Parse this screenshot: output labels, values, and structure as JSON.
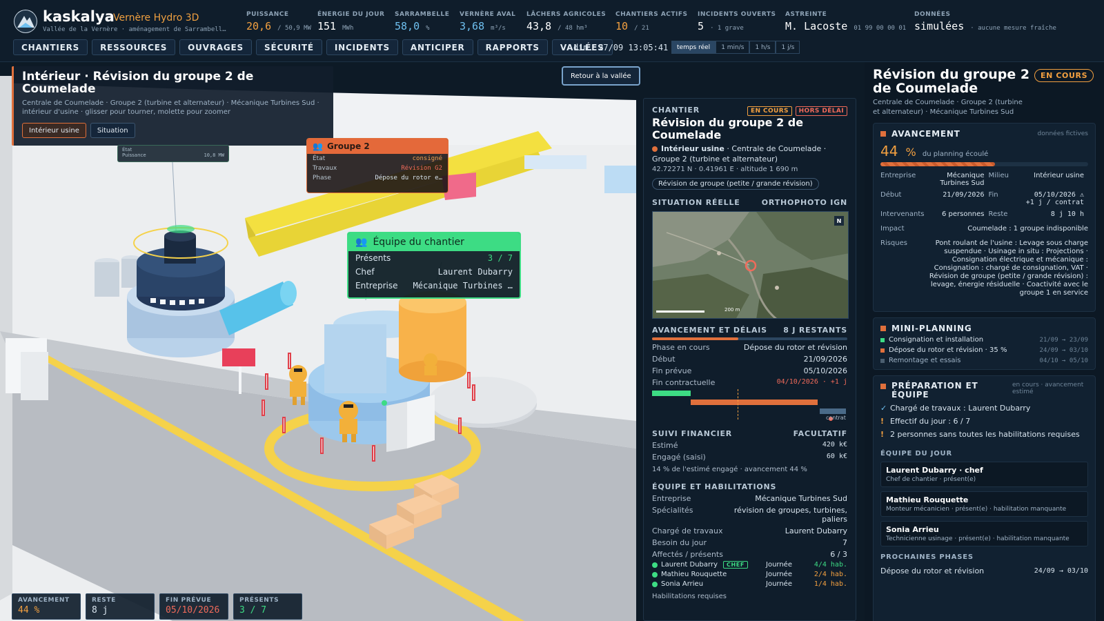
{
  "header": {
    "brand": "kaskalya",
    "product": "Vernère Hydro 3D",
    "location": "Vallée de la Vernère · aménagement de Sarrambell…",
    "kpis": [
      {
        "label": "PUISSANCE",
        "value": "20,6",
        "unit": "/ 50,9 MW",
        "color": "#f3a040"
      },
      {
        "label": "ÉNERGIE DU JOUR",
        "value": "151",
        "unit": "MWh",
        "color": "#ffffff"
      },
      {
        "label": "SARRAMBELLE",
        "value": "58,0",
        "unit": "%",
        "color": "#6fc0f0"
      },
      {
        "label": "VERNÈRE AVAL",
        "value": "3,68",
        "unit": "m³/s",
        "color": "#6fc0f0"
      },
      {
        "label": "LÂCHERS AGRICOLES",
        "value": "43,8",
        "unit": "/ 48 hm³",
        "color": "#ffffff"
      },
      {
        "label": "CHANTIERS ACTIFS",
        "value": "10",
        "unit": "/ 21",
        "color": "#f3a040"
      },
      {
        "label": "INCIDENTS OUVERTS",
        "value": "5",
        "unit": "· 1 grave",
        "color": "#ffffff"
      },
      {
        "label": "ASTREINTE",
        "value": "M. Lacoste",
        "unit": "01 99 00 00 01",
        "color": "#ffffff"
      },
      {
        "label": "DONNÉES",
        "value": "simulées",
        "unit": "· aucune mesure fraîche",
        "color": "#ffffff"
      }
    ],
    "nav": [
      "CHANTIERS",
      "RESSOURCES",
      "OUVRAGES",
      "SÉCURITÉ",
      "INCIDENTS",
      "ANTICIPER",
      "RAPPORTS",
      "VALLÉES"
    ],
    "clock": "dim. 27/09 13:05:41",
    "speeds": [
      "temps réel",
      "1 min/s",
      "1 h/s",
      "1 j/s"
    ],
    "speed_active": "temps réel"
  },
  "scene": {
    "title": "Intérieur · Révision du groupe 2 de Coumelade",
    "sub1": "Centrale de Coumelade · Groupe 2 (turbine et alternateur) · Mécanique Turbines Sud ·",
    "sub2": "intérieur d'usine · glisser pour tourner, molette pour zoomer",
    "views": [
      "Intérieur usine",
      "Situation"
    ],
    "back": "Retour à la vallée",
    "ghost": {
      "k1": "État",
      "k2": "Puissance",
      "v2": "10,8 MW"
    },
    "g2": {
      "title": "Groupe 2",
      "rows": [
        {
          "k": "État",
          "v": "consigné"
        },
        {
          "k": "Travaux",
          "v": "Révision G2"
        },
        {
          "k": "Phase",
          "v": "Dépose du rotor e…"
        }
      ]
    },
    "team": {
      "title": "Équipe du chantier",
      "rows": [
        {
          "k": "Présents",
          "v": "3 / 7"
        },
        {
          "k": "Chef",
          "v": "Laurent Dubarry"
        },
        {
          "k": "Entreprise",
          "v": "Mécanique Turbines …"
        }
      ]
    },
    "bottom": [
      {
        "label": "AVANCEMENT",
        "value": "44 %",
        "color": "#f3a040"
      },
      {
        "label": "RESTE",
        "value": "8 j",
        "color": "#ffffff"
      },
      {
        "label": "FIN PRÉVUE",
        "value": "05/10/2026",
        "color": "#f06a5a"
      },
      {
        "label": "PRÉSENTS",
        "value": "3 / 7",
        "color": "#3ddc84"
      }
    ]
  },
  "mid": {
    "section": "CHANTIER",
    "badge1": "EN COURS",
    "badge2": "HORS DÉLAI",
    "title": "Révision du groupe 2 de Coumelade",
    "line1_bold": "Intérieur usine",
    "line1_rest": " · Centrale de Coumelade ·",
    "line2": "Groupe 2 (turbine et alternateur)",
    "coords": "42.72271 N · 0.41961 E · altitude 1 690 m",
    "pill": "Révision de groupe (petite / grande révision)",
    "map_title": "SITUATION RÉELLE",
    "map_source": "ORTHOPHOTO IGN",
    "map_north": "N",
    "map_scale": "200 m",
    "delay_title": "AVANCEMENT ET DÉLAIS",
    "delay_rest": "8 J RESTANTS",
    "progress": 0.44,
    "delays": [
      {
        "k": "Phase en cours",
        "v": "Dépose du rotor et révision"
      },
      {
        "k": "Début",
        "v": "21/09/2026"
      },
      {
        "k": "Fin prévue",
        "v": "05/10/2026"
      },
      {
        "k": "Fin contractuelle",
        "v": "04/10/2026 · +1 j"
      }
    ],
    "contract_label": "contrat",
    "fin_title": "SUIVI FINANCIER",
    "fin_note": "FACULTATIF",
    "fin": [
      {
        "k": "Estimé",
        "v": "420 k€"
      },
      {
        "k": "Engagé (saisi)",
        "v": "60 k€"
      }
    ],
    "fin_note2": "14 % de l'estimé engagé · avancement 44 %",
    "team_title": "ÉQUIPE ET HABILITATIONS",
    "team": [
      {
        "k": "Entreprise",
        "v": "Mécanique Turbines Sud"
      },
      {
        "k": "Spécialités",
        "v": "révision de groupes, turbines, paliers"
      },
      {
        "k": "Chargé de travaux",
        "v": "Laurent Dubarry"
      },
      {
        "k": "Besoin du jour",
        "v": "7"
      },
      {
        "k": "Affectés / présents",
        "v": "6 / 3"
      }
    ],
    "people": [
      {
        "name": "Laurent Dubarry",
        "chef": "CHEF",
        "shift": "Journée",
        "hab": "4/4 hab.",
        "color": "#3ddc84"
      },
      {
        "name": "Mathieu Rouquette",
        "chef": "",
        "shift": "Journée",
        "hab": "2/4 hab.",
        "color": "#f3a040"
      },
      {
        "name": "Sonia Arrieu",
        "chef": "",
        "shift": "Journée",
        "hab": "1/4 hab.",
        "color": "#f3a040"
      }
    ],
    "hab_title": "Habilitations requises"
  },
  "right": {
    "title": "Révision du groupe 2 de Coumelade",
    "status": "EN COURS",
    "sub": "Centrale de Coumelade · Groupe 2 (turbine et alternateur) · Mécanique Turbines Sud",
    "adv_title": "AVANCEMENT",
    "adv_note": "données fictives",
    "adv_value": "44",
    "adv_unit": "%",
    "adv_desc": "du planning écoulé",
    "progress": 0.55,
    "details": {
      "entreprise_k": "Entreprise",
      "entreprise_v": "Mécanique Turbines Sud",
      "milieu_k": "Milieu",
      "milieu_v": "Intérieur usine",
      "debut_k": "Début",
      "debut_v": "21/09/2026",
      "fin_k": "Fin",
      "fin_v": "05/10/2026 ⚠ +1 j / contrat",
      "interv_k": "Intervenants",
      "interv_v": "6 personnes",
      "reste_k": "Reste",
      "reste_v": "8 j 10 h",
      "impact_k": "Impact",
      "impact_v": "Coumelade : 1 groupe indisponible",
      "risques_k": "Risques",
      "risques_v": "Pont roulant de l'usine : Levage sous charge suspendue · Usinage in situ : Projections · Consignation électrique et mécanique : Consignation : chargé de consignation, VAT · Révision de groupe (petite / grande révision) : levage, énergie résiduelle · Coactivité avec le groupe 1 en service"
    },
    "mini_title": "MINI-PLANNING",
    "mini": [
      {
        "label": "Consignation et installation",
        "dates": "21/09 → 23/09",
        "color": "#3ddc84"
      },
      {
        "label": "Dépose du rotor et révision · 35 %",
        "dates": "24/09 → 03/10",
        "color": "#e0703c"
      },
      {
        "label": "Remontage et essais",
        "dates": "04/10 → 05/10",
        "color": "#4a5e70"
      }
    ],
    "prep_title": "PRÉPARATION ET ÉQUIPE",
    "prep_note": "en cours · avancement estimé",
    "prep": [
      {
        "icon": "✓",
        "text": "Chargé de travaux : Laurent Dubarry",
        "color": "#6fc0f0"
      },
      {
        "icon": "!",
        "text": "Effectif du jour : 6 / 7",
        "color": "#f3a040"
      },
      {
        "icon": "!",
        "text": "2 personnes sans toutes les habilitations requises",
        "color": "#f3a040"
      }
    ],
    "team_title": "ÉQUIPE DU JOUR",
    "team": [
      {
        "name": "Laurent Dubarry · chef",
        "role": "Chef de chantier · présent(e)"
      },
      {
        "name": "Mathieu Rouquette",
        "role": "Monteur mécanicien · présent(e) · habilitation manquante"
      },
      {
        "name": "Sonia Arrieu",
        "role": "Technicienne usinage · présent(e) · habilitation manquante"
      }
    ],
    "next_title": "PROCHAINES PHASES",
    "next_label": "Dépose du rotor et révision",
    "next_dates": "24/09 → 03/10"
  }
}
